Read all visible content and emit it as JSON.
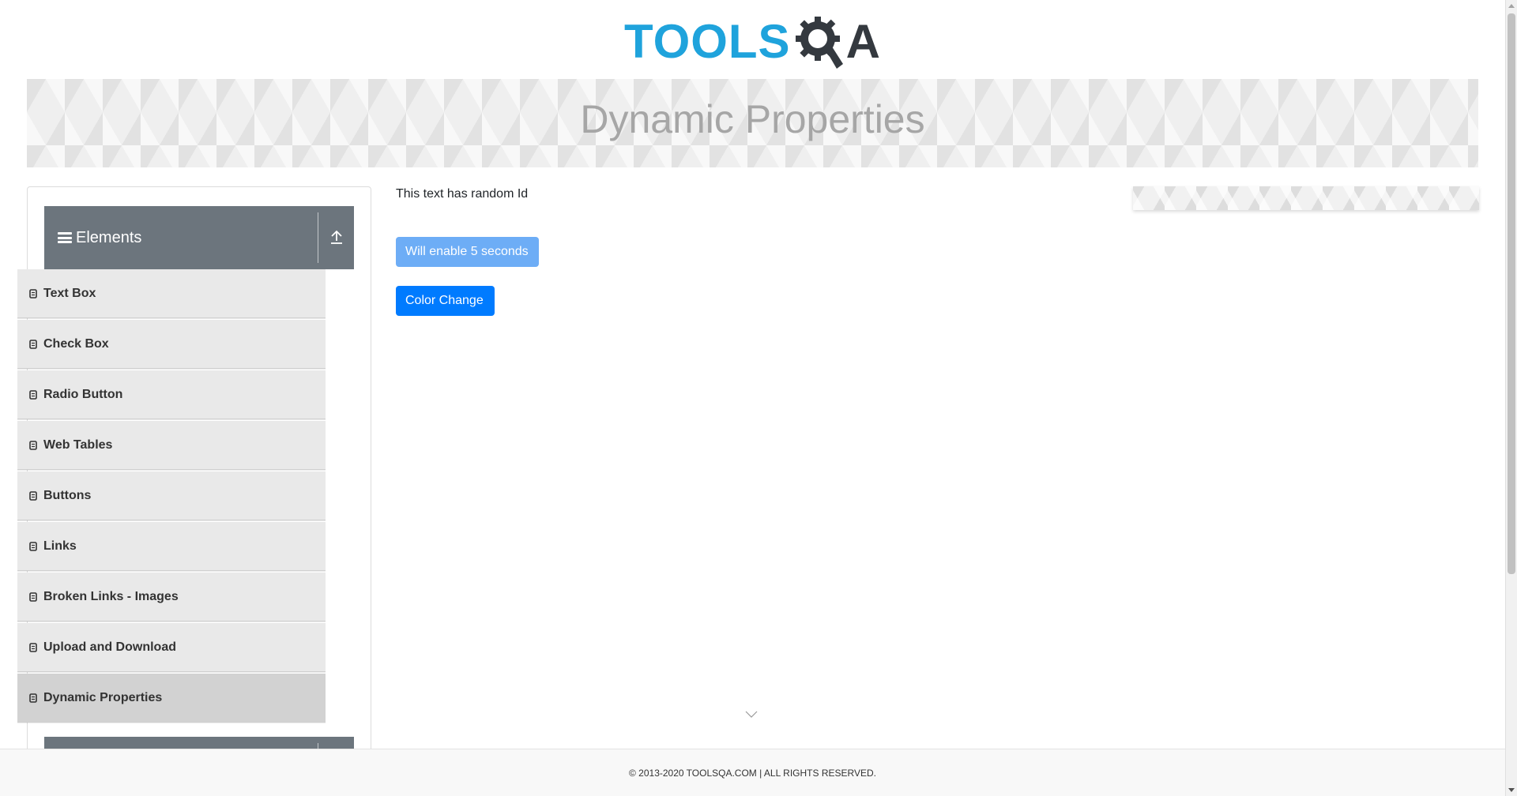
{
  "header": {
    "logo_primary": "TOOLS",
    "logo_suffix": "A",
    "colors": {
      "logo_blue": "#1fa3dc",
      "logo_dark": "#34393f"
    }
  },
  "banner": {
    "title": "Dynamic Properties"
  },
  "sidebar": {
    "group_title": "Elements",
    "group_icon": "hamburger-icon",
    "collapse_icon": "collapse-upload-icon",
    "items": [
      {
        "label": "Text Box",
        "active": false
      },
      {
        "label": "Check Box",
        "active": false
      },
      {
        "label": "Radio Button",
        "active": false
      },
      {
        "label": "Web Tables",
        "active": false
      },
      {
        "label": "Buttons",
        "active": false
      },
      {
        "label": "Links",
        "active": false
      },
      {
        "label": "Broken Links - Images",
        "active": false
      },
      {
        "label": "Upload and Download",
        "active": false
      },
      {
        "label": "Dynamic Properties",
        "active": true
      }
    ]
  },
  "main": {
    "random_id_text": "This text has random Id",
    "enable_button_label": "Will enable 5 seconds",
    "color_change_button_label": "Color Change",
    "colors": {
      "enable_button": "#66a9f6",
      "color_button": "#007bff"
    }
  },
  "footer": {
    "text": "© 2013-2020 TOOLSQA.COM | ALL RIGHTS RESERVED."
  }
}
